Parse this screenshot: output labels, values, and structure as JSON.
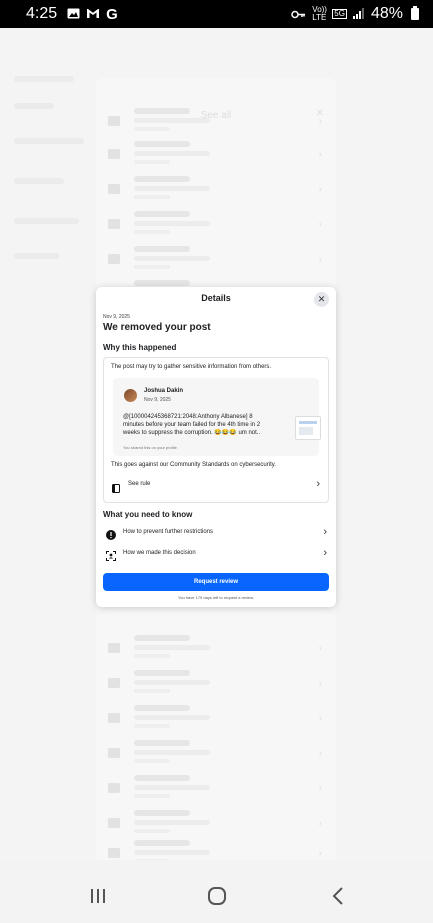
{
  "status_bar": {
    "time": "4:25",
    "icons_left": [
      "gallery-icon",
      "gmail-icon",
      "google-icon"
    ],
    "lte_label": "Vo)) LTE",
    "net_label": "5G",
    "battery": "48%"
  },
  "modal": {
    "title": "Details",
    "date": "Nov 9, 2025",
    "heading": "We removed your post",
    "why_title": "Why this happened",
    "reason": "The post may try to gather sensitive information from others.",
    "post": {
      "author": "Joshua Dakin",
      "date": "Nov 9, 2025",
      "body": "@[100004245368721:2048:Anthony Albanese] 8 minutes before your team failed for the 4th time in 2 weeks to suppress the corruption. 😂😂😂 um not..",
      "shared_note": "You shared this on your profile"
    },
    "against": "This goes against our Community Standards on cybersecurity.",
    "see_rule": "See rule",
    "need_title": "What you need to know",
    "options": [
      {
        "label": "How to prevent further restrictions",
        "icon": "alert-circle-icon"
      },
      {
        "label": "How we made this decision",
        "icon": "scan-icon"
      }
    ],
    "request_review": "Request review",
    "days_note": "You have 179 days left to request a review."
  },
  "background": {
    "title": "See all"
  },
  "colors": {
    "accent": "#0866ff",
    "status_bar": "#000000"
  }
}
